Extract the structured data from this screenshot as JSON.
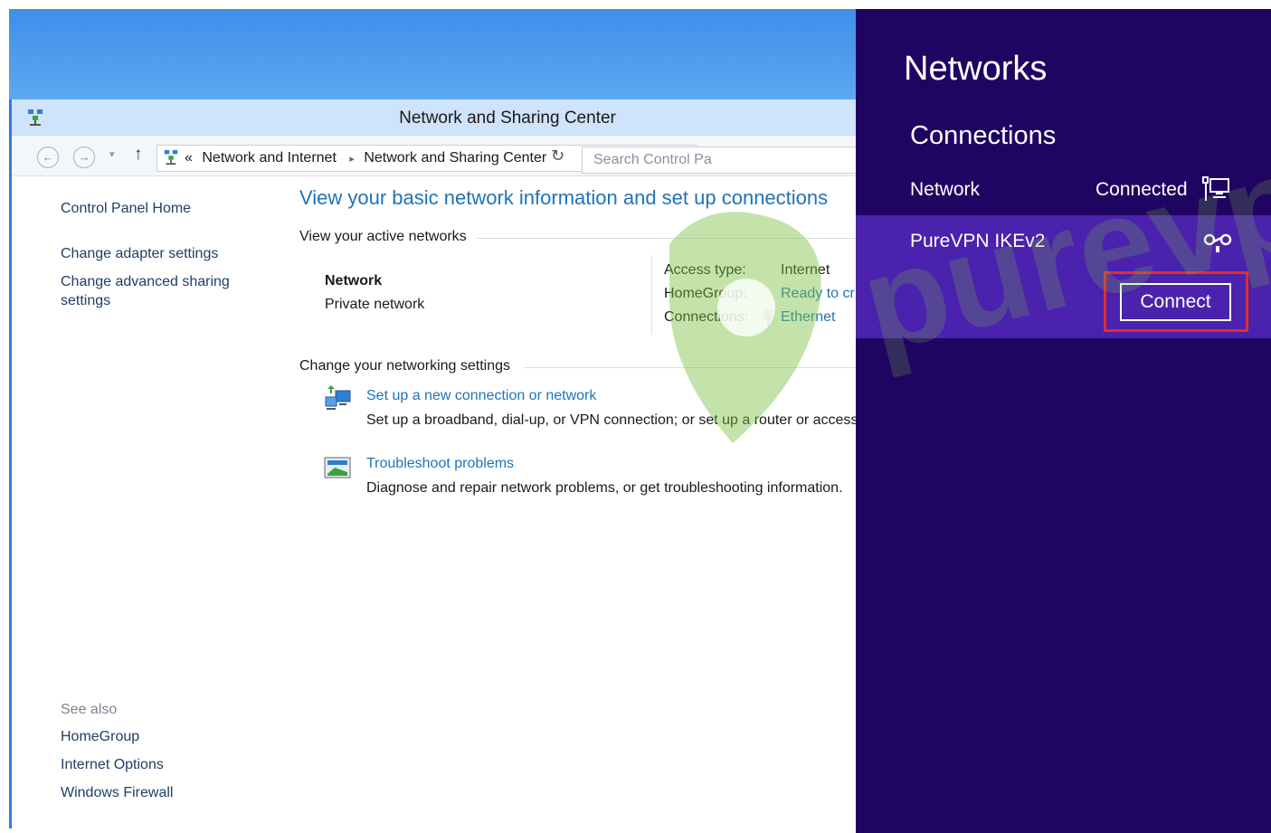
{
  "window": {
    "title": "Network and Sharing Center"
  },
  "navbar": {
    "breadcrumb_root_glyph": "«",
    "breadcrumb": [
      "Network and Internet",
      "Network and Sharing Center"
    ],
    "search_placeholder": "Search Control Pa"
  },
  "left_pane": {
    "home_link": "Control Panel Home",
    "links": [
      "Change adapter settings",
      "Change advanced sharing",
      "settings"
    ],
    "see_also_label": "See also",
    "see_also": [
      "HomeGroup",
      "Internet Options",
      "Windows Firewall"
    ]
  },
  "main": {
    "heading": "View your basic network information and set up connections",
    "active_networks_label": "View your active networks",
    "network_name": "Network",
    "network_type": "Private network",
    "details": [
      {
        "key": "Access type:",
        "value": "Internet"
      },
      {
        "key": "HomeGroup:",
        "value": "Ready to cr"
      },
      {
        "key": "Connections:",
        "value": "Ethernet"
      }
    ],
    "change_settings_label": "Change your networking settings",
    "tasks": [
      {
        "link": "Set up a new connection or network",
        "desc": "Set up a broadband, dial-up, or VPN connection; or set up a router or access"
      },
      {
        "link": "Troubleshoot problems",
        "desc": "Diagnose and repair network problems, or get troubleshooting information."
      }
    ]
  },
  "charm": {
    "title": "Networks",
    "section": "Connections",
    "network_label": "Network",
    "network_status": "Connected",
    "vpn_label": "PureVPN IKEv2",
    "connect_label": "Connect",
    "highlight_color": "#e32c2c",
    "background_color": "#200462",
    "selected_row_color": "#4a22ad"
  },
  "watermark": {
    "text": "purevpn"
  }
}
